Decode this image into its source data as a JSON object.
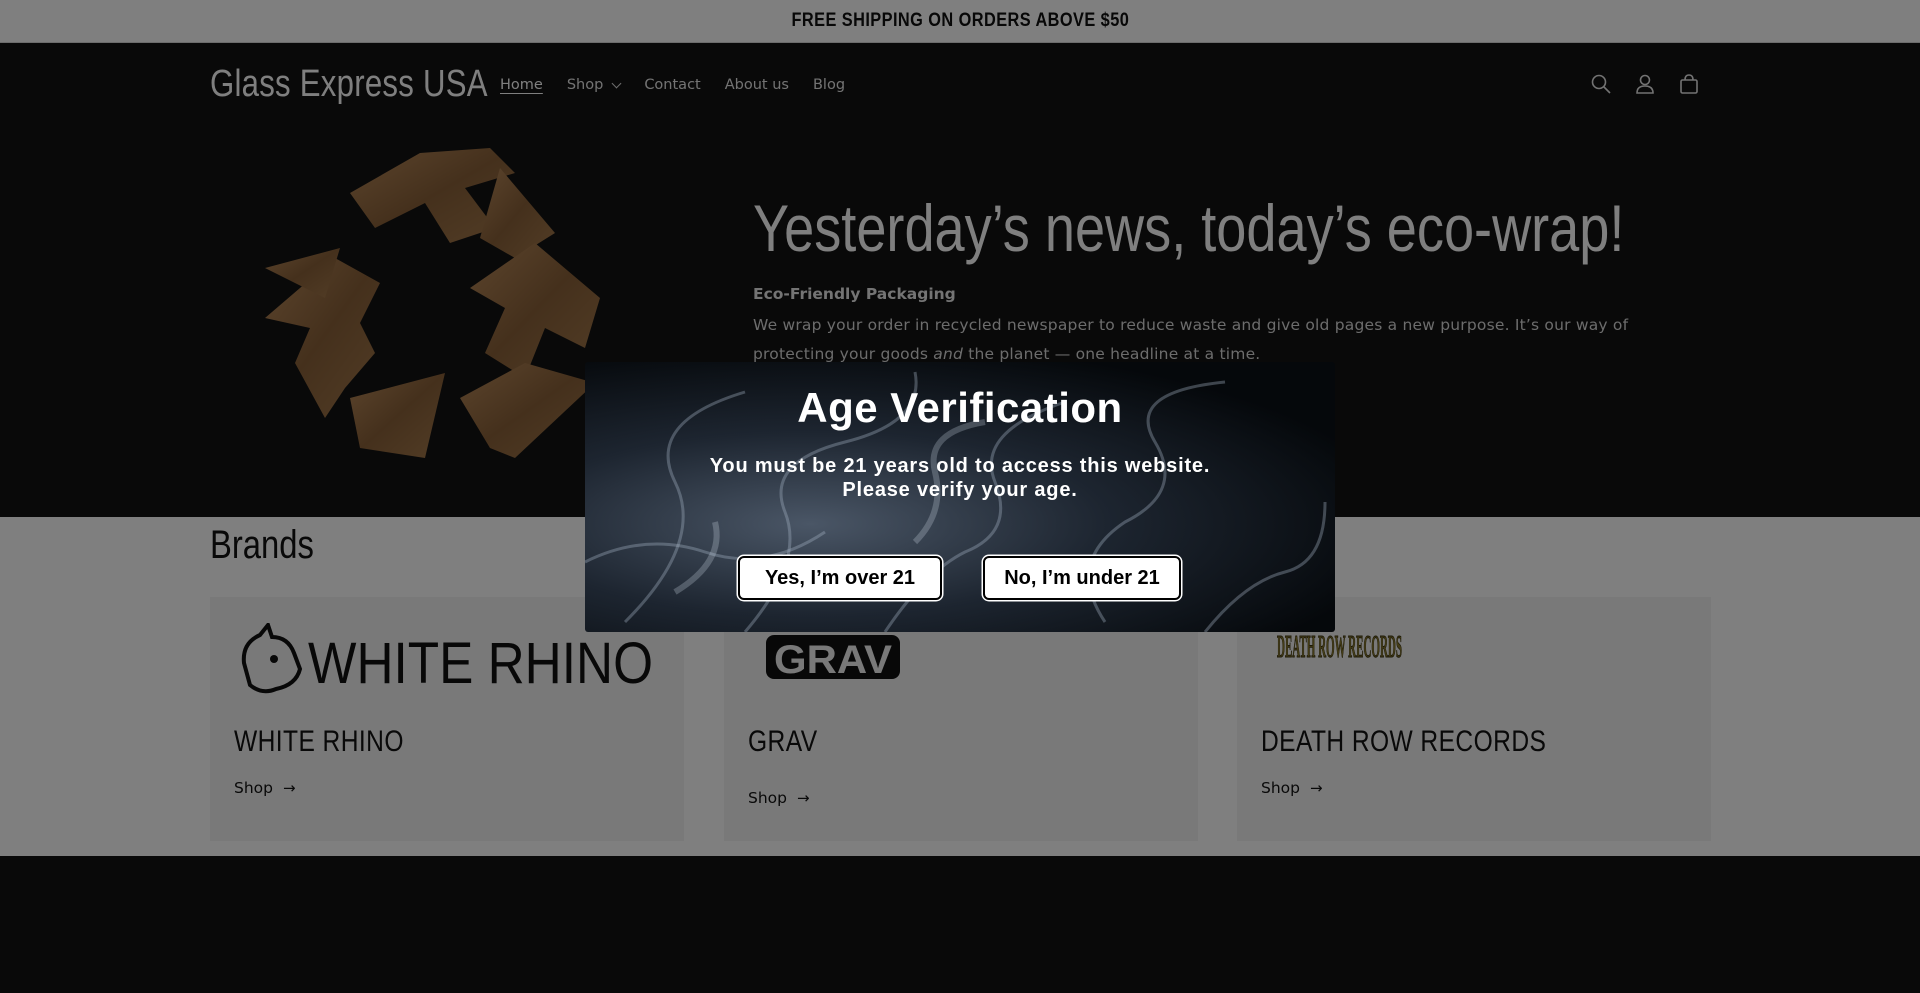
{
  "announcement": "FREE SHIPPING ON ORDERS ABOVE $50",
  "header": {
    "logo": "Glass Express USA",
    "nav": [
      "Home",
      "Shop",
      "Contact",
      "About us",
      "Blog"
    ],
    "icons": [
      "search-icon",
      "account-icon",
      "cart-icon"
    ]
  },
  "hero": {
    "title": "Yesterday’s news, today’s eco-wrap!",
    "subtitle": "Eco-Friendly Packaging",
    "body_part1": "We wrap your order in recycled newspaper to reduce waste and give old pages a new purpose. It’s our way of protecting your goods ",
    "body_em": "and",
    "body_part2": " the planet — one headline at a time."
  },
  "brands": {
    "title": "Brands",
    "cards": [
      {
        "logo_text": "WHITE RHINO",
        "name": "WHITE RHINO",
        "link": "Shop"
      },
      {
        "logo_text": "GRAV",
        "name": "GRAV",
        "link": "Shop"
      },
      {
        "logo_text": "DEATH ROW RECORDS",
        "name": "DEATH ROW RECORDS",
        "link": "Shop"
      }
    ]
  },
  "age_modal": {
    "title": "Age Verification",
    "message_line1": "You must be 21 years old to access this website.",
    "message_line2": "Please verify your age.",
    "yes_label": "Yes, I’m over 21",
    "no_label": "No, I’m under 21"
  },
  "colors": {
    "page_dark": "#121212",
    "announcement_bg": "#ffffff",
    "brand_card_bg": "#f3f3f3",
    "overlay": "rgba(0,0,0,0.5)"
  }
}
